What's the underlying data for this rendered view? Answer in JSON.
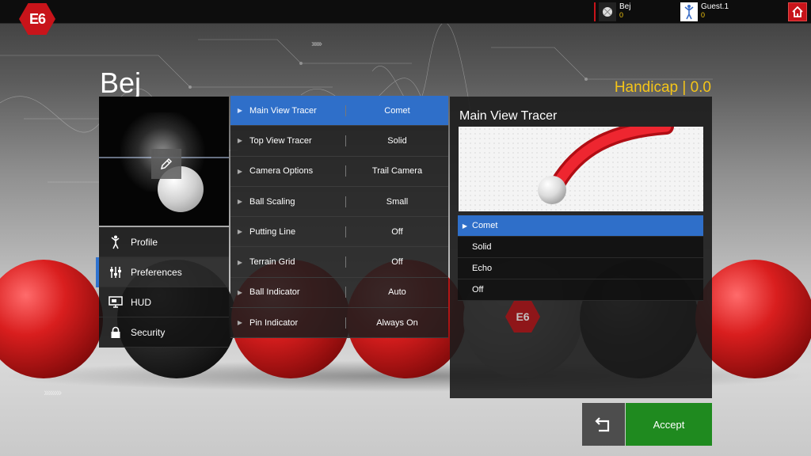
{
  "topbar": {
    "logo_text": "E6",
    "players": [
      {
        "name": "Bej",
        "score": "0"
      },
      {
        "name": "Guest.1",
        "score": "0"
      }
    ],
    "home_icon": "home-icon"
  },
  "profile": {
    "name": "Bej",
    "handicap": "Handicap | 0.0"
  },
  "sidebar": {
    "items": [
      {
        "label": "Profile",
        "icon": "golfer-icon"
      },
      {
        "label": "Preferences",
        "icon": "sliders-icon"
      },
      {
        "label": "HUD",
        "icon": "monitor-icon"
      },
      {
        "label": "Security",
        "icon": "lock-icon"
      }
    ],
    "active": "Preferences"
  },
  "settings": [
    {
      "label": "Main View Tracer",
      "value": "Comet"
    },
    {
      "label": "Top View Tracer",
      "value": "Solid"
    },
    {
      "label": "Camera Options",
      "value": "Trail Camera"
    },
    {
      "label": "Ball Scaling",
      "value": "Small"
    },
    {
      "label": "Putting Line",
      "value": "Off"
    },
    {
      "label": "Terrain Grid",
      "value": "Off"
    },
    {
      "label": "Ball Indicator",
      "value": "Auto"
    },
    {
      "label": "Pin Indicator",
      "value": "Always On"
    }
  ],
  "preview": {
    "title": "Main View Tracer",
    "options": [
      "Comet",
      "Solid",
      "Echo",
      "Off"
    ],
    "selected": "Comet",
    "logo_text": "E6"
  },
  "actions": {
    "back_icon": "undo-icon",
    "accept_label": "Accept"
  },
  "colors": {
    "accent_blue": "#2f6fc9",
    "brand_red": "#c8141a",
    "accept_green": "#1f8a1f",
    "handicap_gold": "#f5c518"
  }
}
